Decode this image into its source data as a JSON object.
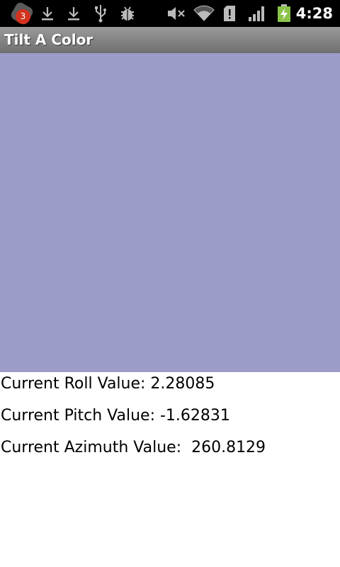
{
  "status_bar": {
    "notification_count": "3",
    "time": "4:28",
    "icons": [
      "notification-icon",
      "download-icon",
      "download-icon",
      "usb-icon",
      "debug-icon",
      "mute-icon",
      "wifi-icon",
      "sd-card-alert-icon",
      "signal-icon",
      "battery-charging-icon"
    ]
  },
  "app": {
    "title": "Tilt A Color"
  },
  "color_panel": {
    "color": "#9c9cc9"
  },
  "readouts": {
    "roll": "Current Roll Value: 2.28085",
    "pitch": "Current Pitch Value: -1.62831",
    "azimuth": "Current Azimuth Value:  260.8129"
  }
}
